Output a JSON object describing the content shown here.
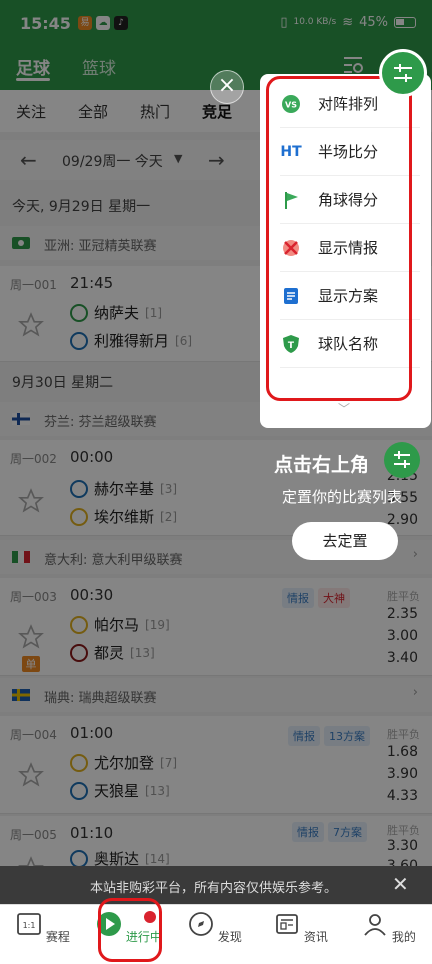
{
  "status": {
    "time": "15:45",
    "net_speed": "10.0 KB/s",
    "battery": "45%"
  },
  "header": {
    "tabs": [
      "足球",
      "篮球"
    ],
    "active_tab": 0
  },
  "subtabs": [
    "关注",
    "全部",
    "热门",
    "竞足"
  ],
  "datebar": {
    "date": "09/29周一 今天"
  },
  "sections": [
    {
      "date": "今天, 9月29日 星期一"
    },
    {
      "date": "9月30日 星期二"
    }
  ],
  "matches": [
    {
      "league": "亚洲: 亚冠精英联赛",
      "no": "周一001",
      "time": "21:45",
      "home": "纳萨夫",
      "home_rank": "[1]",
      "away": "利雅得新月",
      "away_rank": "[6]"
    },
    {
      "league": "芬兰: 芬兰超级联赛",
      "no": "周一002",
      "time": "00:00",
      "home": "赫尔辛基",
      "home_rank": "[3]",
      "away": "埃尔维斯",
      "away_rank": "[2]",
      "odds": [
        "2.15",
        "3.55",
        "2.90"
      ]
    },
    {
      "league": "意大利: 意大利甲级联赛",
      "no": "周一003",
      "time": "00:30",
      "home": "帕尔马",
      "home_rank": "[19]",
      "away": "都灵",
      "away_rank": "[13]",
      "odds_head": "胜平负",
      "odds": [
        "2.35",
        "3.00",
        "3.40"
      ],
      "tags": [
        "情报",
        "大神"
      ],
      "badge": "单"
    },
    {
      "league": "瑞典: 瑞典超级联赛",
      "no": "周一004",
      "time": "01:00",
      "home": "尤尔加登",
      "home_rank": "[7]",
      "away": "天狼星",
      "away_rank": "[13]",
      "odds_head": "胜平负",
      "odds": [
        "1.68",
        "3.90",
        "4.33"
      ],
      "tags": [
        "情报",
        "13方案"
      ]
    },
    {
      "league": "",
      "no": "周一005",
      "time": "01:10",
      "home": "奥斯达",
      "home_rank": "[14]",
      "away": "",
      "away_rank": "",
      "odds_head": "胜平负",
      "odds": [
        "3.30",
        "3.60"
      ],
      "tags": [
        "情报",
        "7方案"
      ]
    }
  ],
  "popup": {
    "items": [
      {
        "icon": "vs-icon",
        "label": "对阵排列"
      },
      {
        "icon": "ht-icon",
        "label": "半场比分"
      },
      {
        "icon": "flag-icon",
        "label": "角球得分"
      },
      {
        "icon": "info-icon",
        "label": "显示情报"
      },
      {
        "icon": "doc-icon",
        "label": "显示方案"
      },
      {
        "icon": "shield-icon",
        "label": "球队名称"
      }
    ]
  },
  "guide": {
    "title": "点击右上角",
    "subtitle": "定置你的比赛列表",
    "button": "去定置"
  },
  "notice": "本站非购彩平台，所有内容仅供娱乐参考。",
  "bottomnav": {
    "items": [
      {
        "icon": "schedule-icon",
        "label": "赛程"
      },
      {
        "icon": "live-icon",
        "label": "进行中"
      },
      {
        "icon": "compass-icon",
        "label": "发现"
      },
      {
        "icon": "news-icon",
        "label": "资讯"
      },
      {
        "icon": "profile-icon",
        "label": "我的"
      }
    ],
    "active": 1
  },
  "colors": {
    "primary": "#2e9a4a",
    "highlight": "#e0181b"
  }
}
